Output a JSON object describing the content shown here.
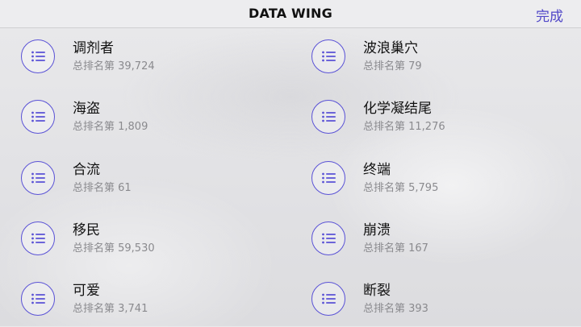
{
  "header": {
    "title": "DATA WING",
    "done_label": "完成"
  },
  "colors": {
    "accent": "#5148c8",
    "icon_ring": "#5a52d6",
    "secondary_text": "#8a8a8e"
  },
  "items": [
    {
      "name": "调剂者",
      "rank": "总排名第 39,724",
      "icon": "list-icon"
    },
    {
      "name": "波浪巢穴",
      "rank": "总排名第 79",
      "icon": "list-icon"
    },
    {
      "name": "海盗",
      "rank": "总排名第 1,809",
      "icon": "list-icon"
    },
    {
      "name": "化学凝结尾",
      "rank": "总排名第 11,276",
      "icon": "list-icon"
    },
    {
      "name": "合流",
      "rank": "总排名第 61",
      "icon": "list-icon"
    },
    {
      "name": "终端",
      "rank": "总排名第 5,795",
      "icon": "list-icon"
    },
    {
      "name": "移民",
      "rank": "总排名第 59,530",
      "icon": "list-icon"
    },
    {
      "name": "崩溃",
      "rank": "总排名第 167",
      "icon": "list-icon"
    },
    {
      "name": "可爱",
      "rank": "总排名第 3,741",
      "icon": "list-icon"
    },
    {
      "name": "断裂",
      "rank": "总排名第 393",
      "icon": "list-icon"
    }
  ]
}
